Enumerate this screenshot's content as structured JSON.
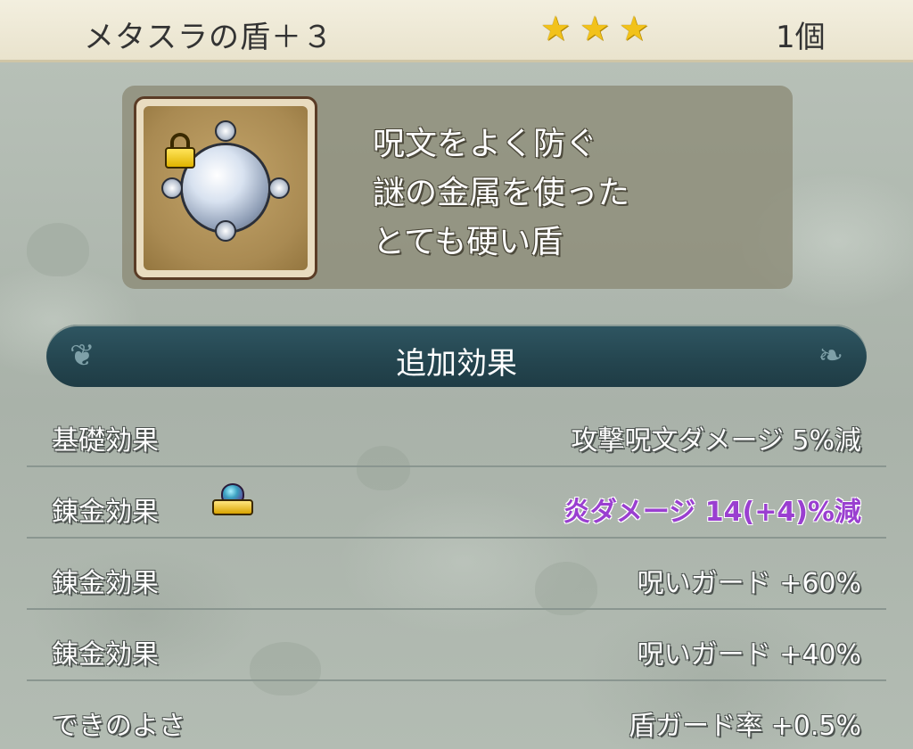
{
  "header": {
    "item_name": "メタスラの盾＋３",
    "stars": [
      "★",
      "★",
      "★"
    ],
    "quantity": "1個"
  },
  "item": {
    "icon": "metal-slime-shield-icon",
    "locked": true,
    "description_lines": [
      "呪文をよく防ぐ",
      "謎の金属を使った",
      "とても硬い盾"
    ]
  },
  "section": {
    "title": "追加効果"
  },
  "effects": [
    {
      "label": "基礎効果",
      "value": "攻撃呪文ダメージ 5%減",
      "highlight": false,
      "crown": false
    },
    {
      "label": "錬金効果",
      "value": "炎ダメージ 14(+4)%減",
      "highlight": true,
      "crown": true
    },
    {
      "label": "錬金効果",
      "value": "呪いガード +60%",
      "highlight": false,
      "crown": false
    },
    {
      "label": "錬金効果",
      "value": "呪いガード +40%",
      "highlight": false,
      "crown": false
    },
    {
      "label": "できのよさ",
      "value": "盾ガード率 +0.5%",
      "highlight": false,
      "crown": false
    }
  ],
  "colors": {
    "header_bg": "#f3efdf",
    "section_bar": "#24454f",
    "highlight_text": "#9a3fd0",
    "star": "#f2c21a"
  }
}
